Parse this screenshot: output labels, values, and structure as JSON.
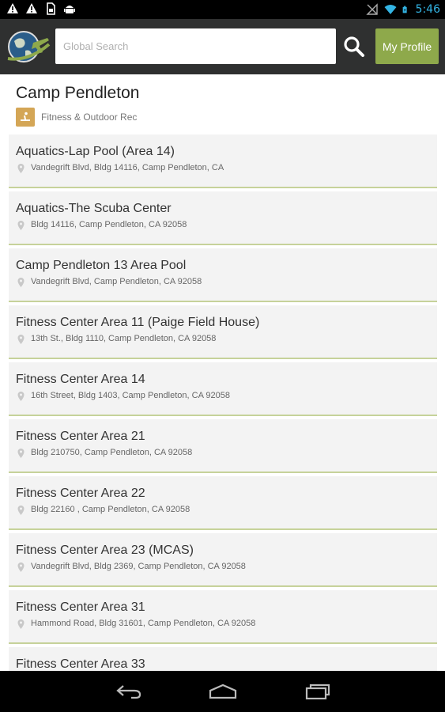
{
  "status_bar": {
    "time": "5:46",
    "left_icons": [
      "warning-icon",
      "warning-icon",
      "sim-card-icon",
      "android-icon"
    ],
    "right_icons": [
      "no-signal-icon",
      "wifi-icon",
      "battery-icon"
    ],
    "time_color": "#33b5e5"
  },
  "app_bar": {
    "logo": "globe-jet-logo",
    "search_placeholder": "Global Search",
    "search_value": "",
    "profile_label": "My Profile",
    "accent_color": "#8ea94b"
  },
  "page": {
    "title": "Camp Pendleton",
    "category_label": "Fitness & Outdoor Rec",
    "category_icon": "fitness-icon"
  },
  "locations": [
    {
      "name": "Aquatics-Lap Pool (Area 14)",
      "address": "Vandegrift Blvd, Bldg 14116, Camp Pendleton, CA"
    },
    {
      "name": "Aquatics-The Scuba Center",
      "address": "Bldg 14116, Camp Pendleton, CA 92058"
    },
    {
      "name": "Camp Pendleton 13 Area Pool",
      "address": "Vandegrift Blvd, Camp Pendleton, CA 92058"
    },
    {
      "name": "Fitness Center Area 11 (Paige Field House)",
      "address": "13th St., Bldg 1110, Camp Pendleton, CA 92058"
    },
    {
      "name": "Fitness Center Area 14",
      "address": "16th Street, Bldg 1403, Camp Pendleton, CA 92058"
    },
    {
      "name": "Fitness Center Area 21",
      "address": "Bldg 210750, Camp Pendleton, CA 92058"
    },
    {
      "name": "Fitness Center Area 22",
      "address": "Bldg 22160 , Camp Pendleton, CA 92058"
    },
    {
      "name": "Fitness Center Area 23 (MCAS)",
      "address": "Vandegrift Blvd, Bldg 2369, Camp Pendleton, CA 92058"
    },
    {
      "name": "Fitness Center Area 31",
      "address": "Hammond Road, Bldg 31601, Camp Pendleton, CA 92058"
    },
    {
      "name": "Fitness Center Area 33",
      "address": ""
    }
  ],
  "nav_bar": {
    "buttons": [
      "back-icon",
      "home-icon",
      "recent-apps-icon"
    ]
  }
}
